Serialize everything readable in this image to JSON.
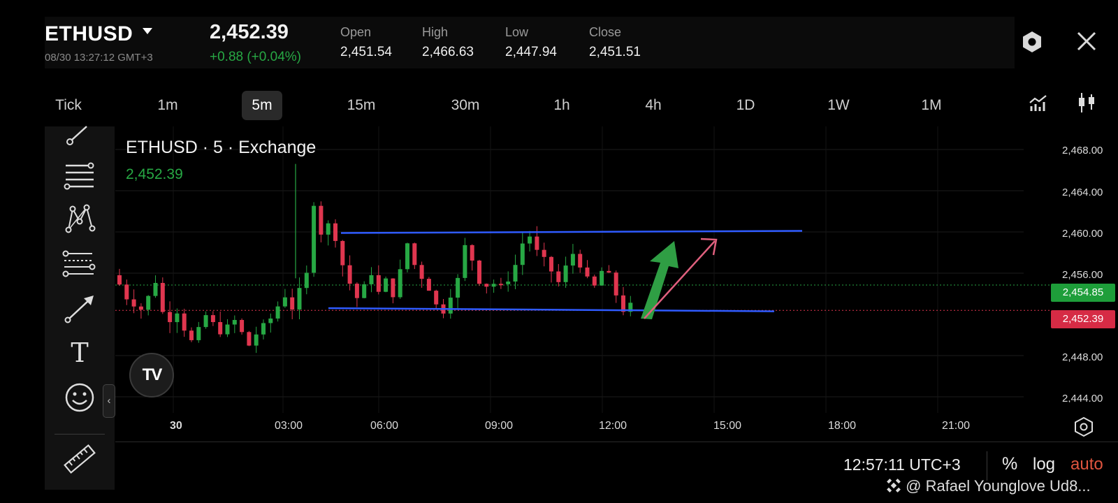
{
  "header": {
    "symbol": "ETHUSD",
    "datetime": "08/30 13:27:12 GMT+3",
    "last_price": "2,452.39",
    "change": "+0.88 (+0.04%)",
    "ohlc": [
      {
        "label": "Open",
        "value": "2,451.54"
      },
      {
        "label": "High",
        "value": "2,466.63"
      },
      {
        "label": "Low",
        "value": "2,447.94"
      },
      {
        "label": "Close",
        "value": "2,451.51"
      }
    ]
  },
  "timeframes": {
    "items": [
      "Tick",
      "1m",
      "5m",
      "15m",
      "30m",
      "1h",
      "4h",
      "1D",
      "1W",
      "1M"
    ],
    "selected": "5m"
  },
  "sidebar": {
    "tools": [
      "trend-line-tool",
      "horizontal-lines-tool",
      "pattern-tool",
      "fib-levels-tool",
      "arrow-tool",
      "text-tool",
      "emoji-tool",
      "ruler-tool"
    ],
    "text_tool_label": "T",
    "collapse_label": "‹"
  },
  "chart": {
    "legend_symbol": "ETHUSD · 5 · Exchange",
    "legend_price": "2,452.39",
    "y_ticks": [
      "2,468.00",
      "2,464.00",
      "2,460.00",
      "2,456.00",
      "2,448.00",
      "2,444.00"
    ],
    "y_tick_values": [
      2468,
      2464,
      2460,
      2456,
      2448,
      2444
    ],
    "x_ticks": [
      "30",
      "03:00",
      "06:00",
      "09:00",
      "12:00",
      "15:00",
      "18:00",
      "21:00"
    ],
    "price_tags": [
      {
        "value": "2,454.85",
        "color": "#1e9e3a"
      },
      {
        "value": "2,452.39",
        "color": "#d62b45"
      }
    ],
    "colors": {
      "up": "#27a844",
      "down": "#e0364f",
      "channel": "#2f5bff",
      "arrow_green": "#2f9e44",
      "arrow_pink": "#e0607e"
    },
    "logo_text": "TV"
  },
  "chart_data": {
    "type": "candlestick",
    "x": [
      "30",
      "03:00",
      "06:00",
      "09:00",
      "12:00",
      "15:00",
      "18:00",
      "21:00"
    ],
    "ylim": [
      2444,
      2470
    ],
    "reference_lines": [
      2454.85,
      2452.39
    ],
    "close_path": [
      2455.8,
      2454.9,
      2453.6,
      2453.0,
      2452.5,
      2453.7,
      2455.2,
      2452.2,
      2451.5,
      2452.3,
      2450.6,
      2449.4,
      2450.5,
      2451.9,
      2451.1,
      2450.3,
      2450.8,
      2451.4,
      2450.2,
      2449.0,
      2450.1,
      2450.9,
      2451.6,
      2452.8,
      2453.8,
      2452.6,
      2454.3,
      2455.9,
      2462.8,
      2459.9,
      2460.7,
      2459.4,
      2456.8,
      2455.0,
      2453.6,
      2454.7,
      2456.0,
      2454.1,
      2455.3,
      2453.9,
      2456.2,
      2458.9,
      2456.8,
      2455.6,
      2454.5,
      2452.9,
      2452.3,
      2453.9,
      2455.4,
      2458.6,
      2457.3,
      2455.2,
      2454.8,
      2455.0,
      2454.7,
      2455.4,
      2456.8,
      2458.9,
      2459.6,
      2458.1,
      2457.3,
      2456.2,
      2455.1,
      2456.6,
      2457.9,
      2456.8,
      2455.4,
      2454.7,
      2456.2,
      2455.8,
      2453.9,
      2452.4,
      2452.9
    ]
  },
  "footer": {
    "clock": "12:57:11 UTC+3",
    "percent": "%",
    "log": "log",
    "auto": "auto",
    "watermark": "@ Rafael Younglove Ud8..."
  }
}
